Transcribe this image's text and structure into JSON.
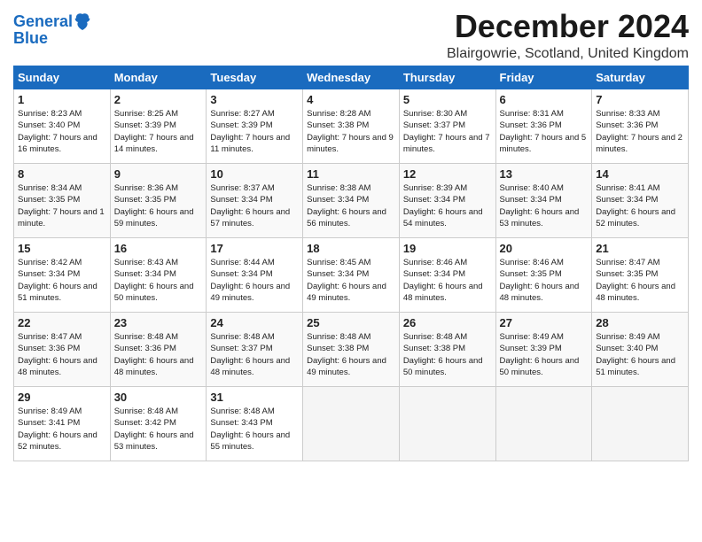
{
  "header": {
    "logo_line1": "General",
    "logo_line2": "Blue",
    "title": "December 2024",
    "location": "Blairgowrie, Scotland, United Kingdom"
  },
  "weekdays": [
    "Sunday",
    "Monday",
    "Tuesday",
    "Wednesday",
    "Thursday",
    "Friday",
    "Saturday"
  ],
  "weeks": [
    [
      {
        "day": "1",
        "sunrise": "8:23 AM",
        "sunset": "3:40 PM",
        "daylight": "7 hours and 16 minutes."
      },
      {
        "day": "2",
        "sunrise": "8:25 AM",
        "sunset": "3:39 PM",
        "daylight": "7 hours and 14 minutes."
      },
      {
        "day": "3",
        "sunrise": "8:27 AM",
        "sunset": "3:39 PM",
        "daylight": "7 hours and 11 minutes."
      },
      {
        "day": "4",
        "sunrise": "8:28 AM",
        "sunset": "3:38 PM",
        "daylight": "7 hours and 9 minutes."
      },
      {
        "day": "5",
        "sunrise": "8:30 AM",
        "sunset": "3:37 PM",
        "daylight": "7 hours and 7 minutes."
      },
      {
        "day": "6",
        "sunrise": "8:31 AM",
        "sunset": "3:36 PM",
        "daylight": "7 hours and 5 minutes."
      },
      {
        "day": "7",
        "sunrise": "8:33 AM",
        "sunset": "3:36 PM",
        "daylight": "7 hours and 2 minutes."
      }
    ],
    [
      {
        "day": "8",
        "sunrise": "8:34 AM",
        "sunset": "3:35 PM",
        "daylight": "7 hours and 1 minute."
      },
      {
        "day": "9",
        "sunrise": "8:36 AM",
        "sunset": "3:35 PM",
        "daylight": "6 hours and 59 minutes."
      },
      {
        "day": "10",
        "sunrise": "8:37 AM",
        "sunset": "3:34 PM",
        "daylight": "6 hours and 57 minutes."
      },
      {
        "day": "11",
        "sunrise": "8:38 AM",
        "sunset": "3:34 PM",
        "daylight": "6 hours and 56 minutes."
      },
      {
        "day": "12",
        "sunrise": "8:39 AM",
        "sunset": "3:34 PM",
        "daylight": "6 hours and 54 minutes."
      },
      {
        "day": "13",
        "sunrise": "8:40 AM",
        "sunset": "3:34 PM",
        "daylight": "6 hours and 53 minutes."
      },
      {
        "day": "14",
        "sunrise": "8:41 AM",
        "sunset": "3:34 PM",
        "daylight": "6 hours and 52 minutes."
      }
    ],
    [
      {
        "day": "15",
        "sunrise": "8:42 AM",
        "sunset": "3:34 PM",
        "daylight": "6 hours and 51 minutes."
      },
      {
        "day": "16",
        "sunrise": "8:43 AM",
        "sunset": "3:34 PM",
        "daylight": "6 hours and 50 minutes."
      },
      {
        "day": "17",
        "sunrise": "8:44 AM",
        "sunset": "3:34 PM",
        "daylight": "6 hours and 49 minutes."
      },
      {
        "day": "18",
        "sunrise": "8:45 AM",
        "sunset": "3:34 PM",
        "daylight": "6 hours and 49 minutes."
      },
      {
        "day": "19",
        "sunrise": "8:46 AM",
        "sunset": "3:34 PM",
        "daylight": "6 hours and 48 minutes."
      },
      {
        "day": "20",
        "sunrise": "8:46 AM",
        "sunset": "3:35 PM",
        "daylight": "6 hours and 48 minutes."
      },
      {
        "day": "21",
        "sunrise": "8:47 AM",
        "sunset": "3:35 PM",
        "daylight": "6 hours and 48 minutes."
      }
    ],
    [
      {
        "day": "22",
        "sunrise": "8:47 AM",
        "sunset": "3:36 PM",
        "daylight": "6 hours and 48 minutes."
      },
      {
        "day": "23",
        "sunrise": "8:48 AM",
        "sunset": "3:36 PM",
        "daylight": "6 hours and 48 minutes."
      },
      {
        "day": "24",
        "sunrise": "8:48 AM",
        "sunset": "3:37 PM",
        "daylight": "6 hours and 48 minutes."
      },
      {
        "day": "25",
        "sunrise": "8:48 AM",
        "sunset": "3:38 PM",
        "daylight": "6 hours and 49 minutes."
      },
      {
        "day": "26",
        "sunrise": "8:48 AM",
        "sunset": "3:38 PM",
        "daylight": "6 hours and 50 minutes."
      },
      {
        "day": "27",
        "sunrise": "8:49 AM",
        "sunset": "3:39 PM",
        "daylight": "6 hours and 50 minutes."
      },
      {
        "day": "28",
        "sunrise": "8:49 AM",
        "sunset": "3:40 PM",
        "daylight": "6 hours and 51 minutes."
      }
    ],
    [
      {
        "day": "29",
        "sunrise": "8:49 AM",
        "sunset": "3:41 PM",
        "daylight": "6 hours and 52 minutes."
      },
      {
        "day": "30",
        "sunrise": "8:48 AM",
        "sunset": "3:42 PM",
        "daylight": "6 hours and 53 minutes."
      },
      {
        "day": "31",
        "sunrise": "8:48 AM",
        "sunset": "3:43 PM",
        "daylight": "6 hours and 55 minutes."
      },
      null,
      null,
      null,
      null
    ]
  ]
}
